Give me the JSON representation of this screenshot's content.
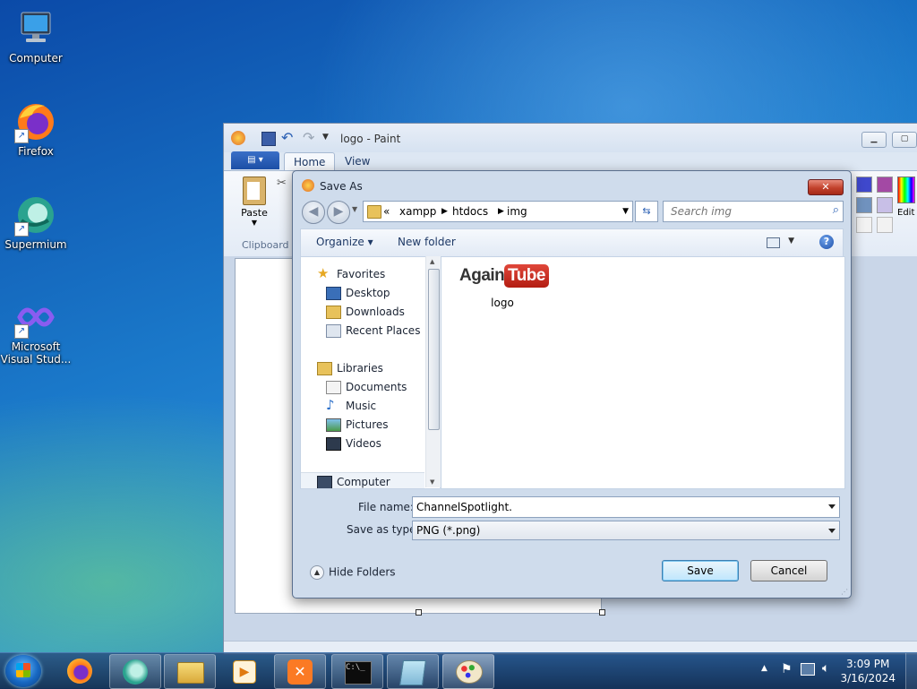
{
  "desktop": {
    "icons": [
      {
        "label": "Computer"
      },
      {
        "label": "Firefox"
      },
      {
        "label": "Supermium"
      },
      {
        "label": "Microsoft Visual Stud..."
      }
    ]
  },
  "paint": {
    "title": "logo - Paint",
    "tabs": [
      "Home",
      "View"
    ],
    "ribbon": {
      "paste_label": "Paste",
      "clipboard_group": "Clipboard",
      "edit_colors_label": "Edit colo"
    }
  },
  "dialog": {
    "title": "Save As",
    "breadcrumb": [
      "xampp",
      "htdocs",
      "img"
    ],
    "breadcrumb_prefix": "«",
    "search_placeholder": "Search img",
    "toolbar": {
      "organize": "Organize",
      "new_folder": "New folder"
    },
    "nav": {
      "favorites": "Favorites",
      "favorites_items": [
        "Desktop",
        "Downloads",
        "Recent Places"
      ],
      "libraries": "Libraries",
      "libraries_items": [
        "Documents",
        "Music",
        "Pictures",
        "Videos"
      ],
      "computer": "Computer"
    },
    "files": [
      {
        "name": "logo",
        "logo_part1": "Again",
        "logo_part2": "Tube"
      }
    ],
    "file_name_label": "File name:",
    "file_name_value": "ChannelSpotlight.",
    "save_type_label": "Save as type:",
    "save_type_value": "PNG (*.png)",
    "hide_folders": "Hide Folders",
    "save_button": "Save",
    "cancel_button": "Cancel"
  },
  "taskbar": {
    "time": "3:09 PM",
    "date": "3/16/2024"
  }
}
